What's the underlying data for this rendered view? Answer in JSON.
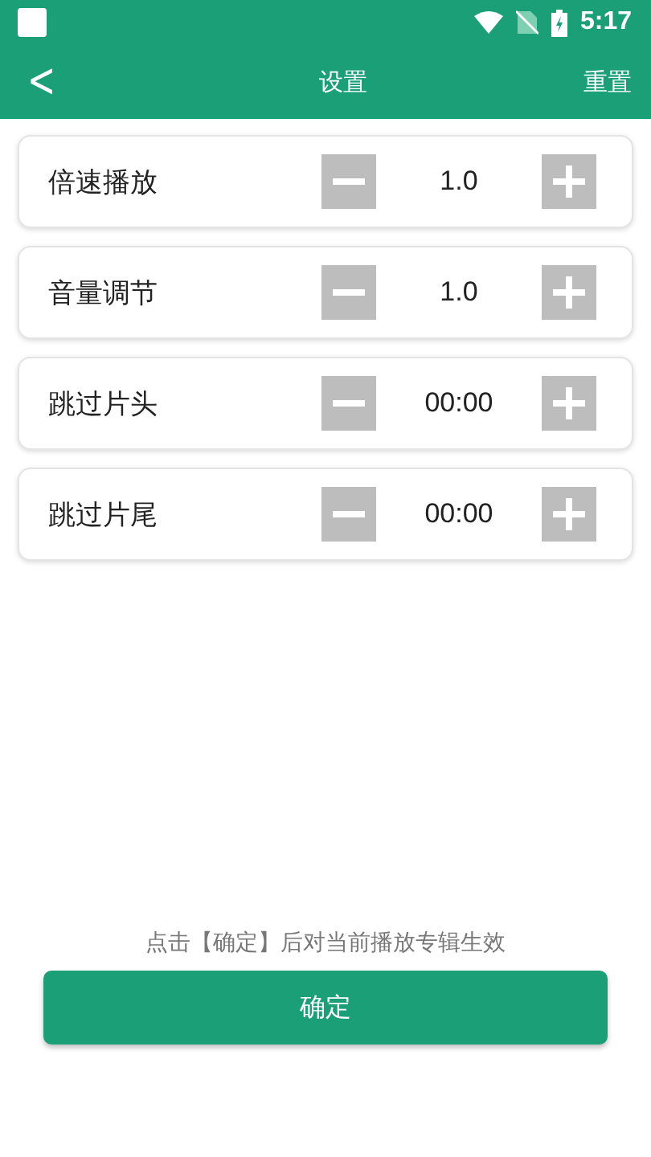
{
  "status_bar": {
    "time": "5:17"
  },
  "header": {
    "back": "<",
    "title": "设置",
    "action": "重置"
  },
  "settings": [
    {
      "label": "倍速播放",
      "value": "1.0"
    },
    {
      "label": "音量调节",
      "value": "1.0"
    },
    {
      "label": "跳过片头",
      "value": "00:00"
    },
    {
      "label": "跳过片尾",
      "value": "00:00"
    }
  ],
  "hint": "点击【确定】后对当前播放专辑生效",
  "confirm_button": "确定"
}
